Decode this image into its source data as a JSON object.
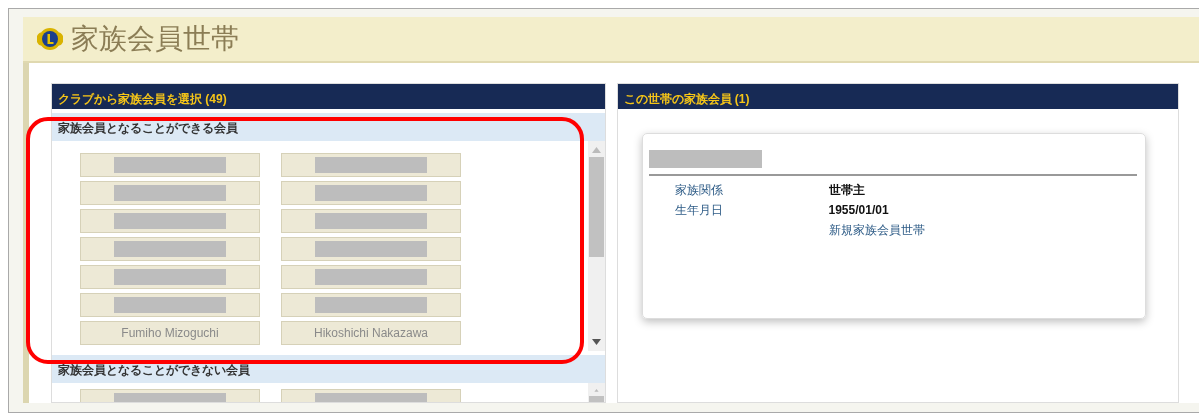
{
  "page": {
    "title": "家族会員世帯"
  },
  "left_panel": {
    "header": "クラブから家族会員を選択 (49)",
    "sections": [
      {
        "heading": "家族会員となることができる会員",
        "members": [
          {
            "redacted": true
          },
          {
            "redacted": true
          },
          {
            "redacted": true
          },
          {
            "redacted": true
          },
          {
            "redacted": true
          },
          {
            "redacted": true
          },
          {
            "redacted": true
          },
          {
            "redacted": true
          },
          {
            "redacted": true
          },
          {
            "redacted": true
          },
          {
            "redacted": true
          },
          {
            "redacted": true
          },
          {
            "name": "Fumiho  Mizoguchi",
            "redacted": false
          },
          {
            "name": "Hikoshichi  Nakazawa",
            "redacted": false
          }
        ]
      },
      {
        "heading": "家族会員となることができない会員",
        "members": [
          {
            "redacted": true
          },
          {
            "redacted": true
          }
        ]
      }
    ]
  },
  "right_panel": {
    "header": "この世帯の家族会員 (1)",
    "card": {
      "name_redacted": true,
      "fields": [
        {
          "label": "家族関係",
          "value": "世帯主"
        },
        {
          "label": "生年月日",
          "value": "1955/01/01"
        }
      ],
      "link": "新規家族会員世帯"
    }
  },
  "annotation": {
    "kind": "outline"
  }
}
